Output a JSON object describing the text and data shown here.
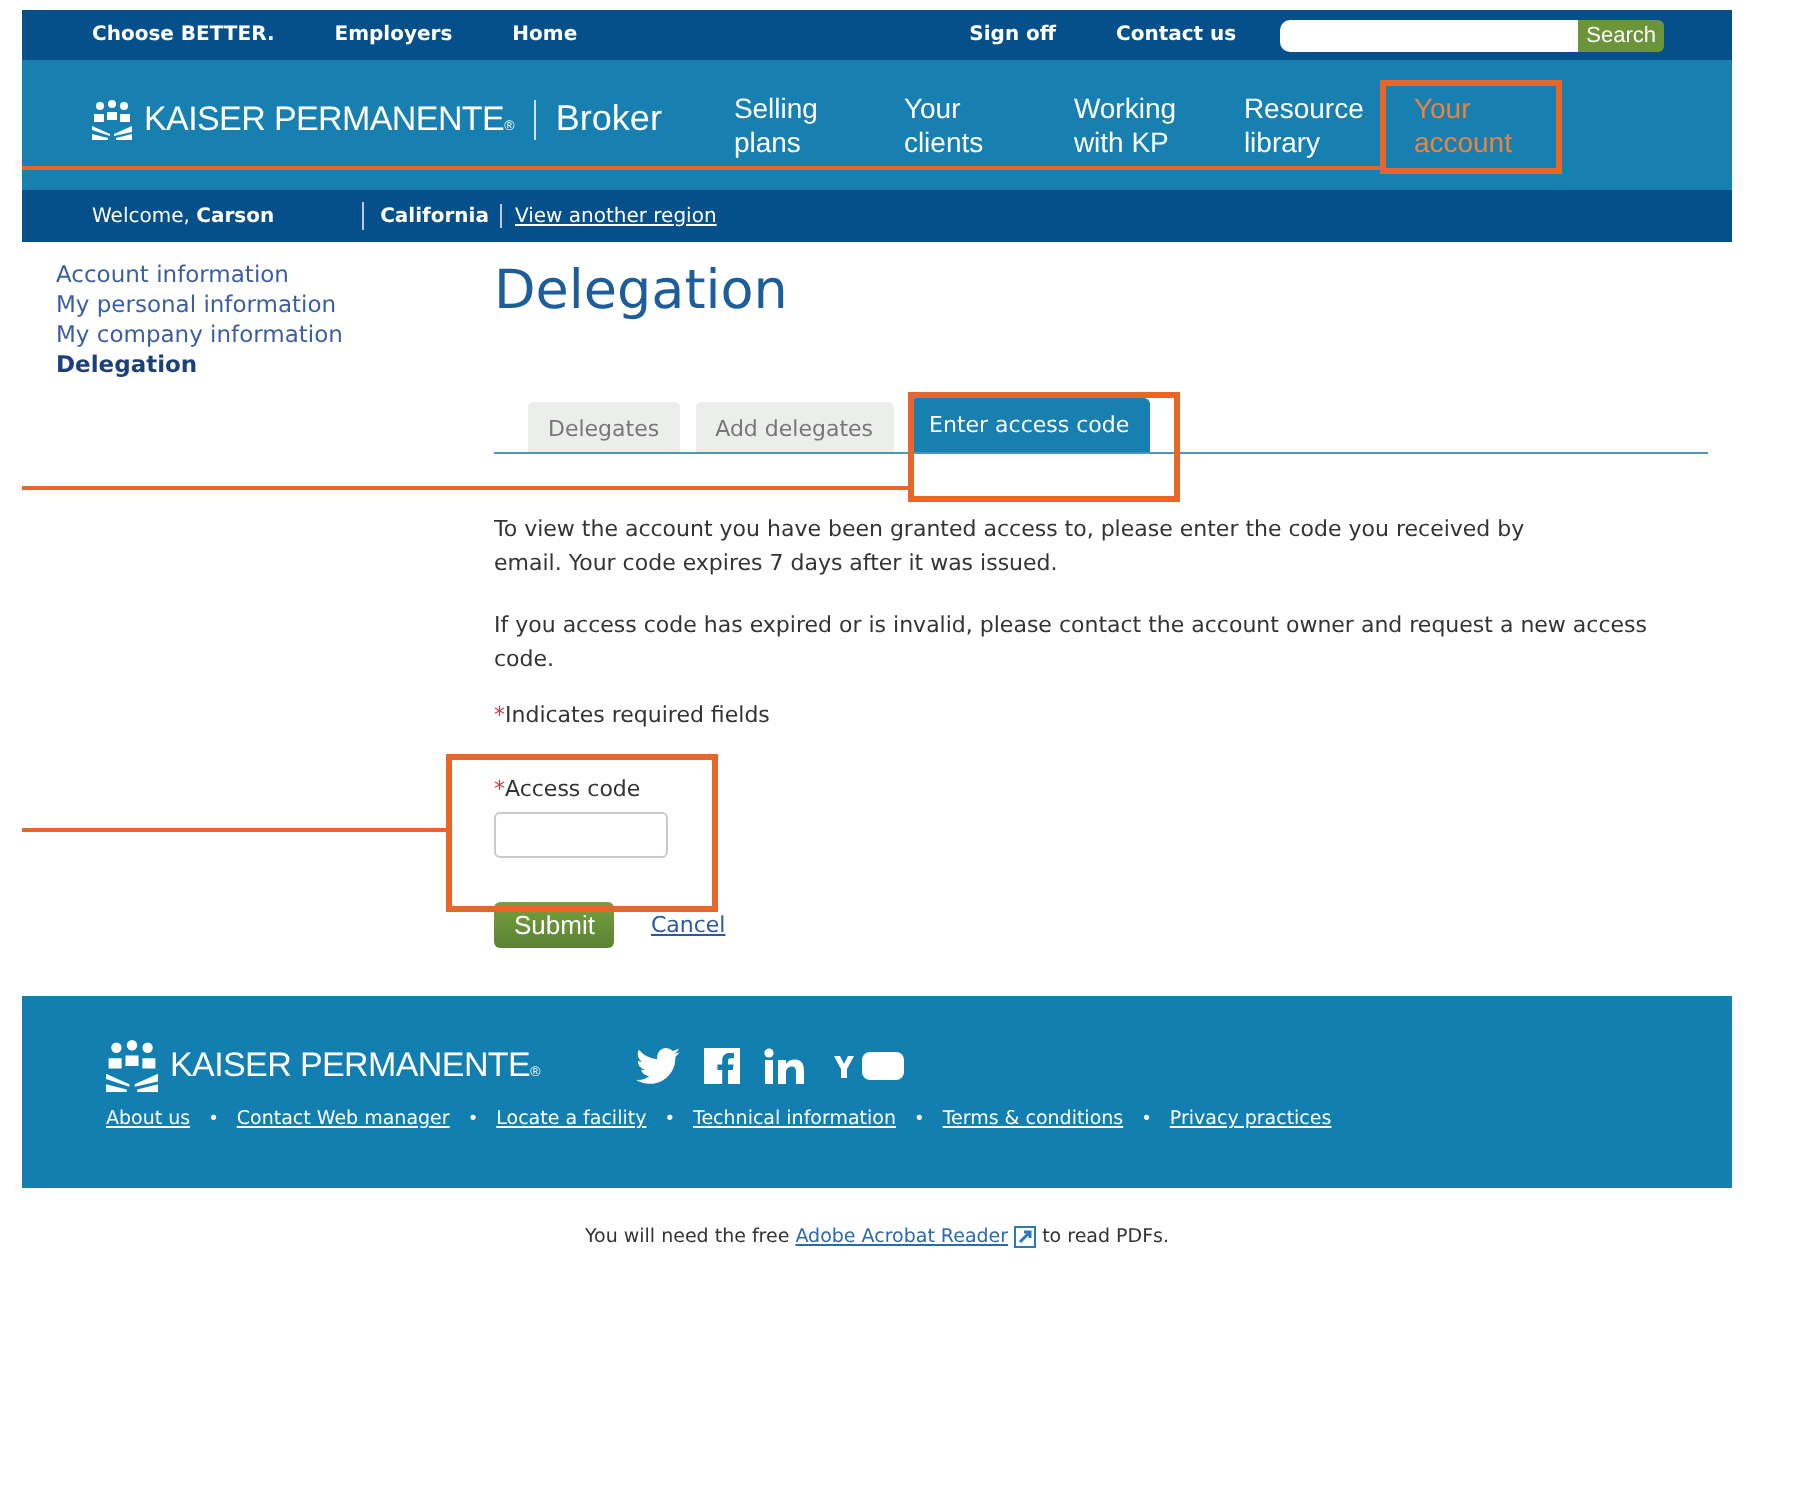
{
  "top_bar": {
    "links": [
      "Choose BETTER.",
      "Employers",
      "Home"
    ],
    "right_links": [
      "Sign off",
      "Contact us"
    ],
    "search": {
      "button": "Search"
    }
  },
  "header": {
    "logo_text": "KAISER PERMANENTE$_{®}$",
    "section": "Broker",
    "nav": [
      {
        "label": "Selling plans",
        "selected": false
      },
      {
        "label": "Your clients",
        "selected": false
      },
      {
        "label": "Working with KP",
        "selected": false
      },
      {
        "label": "Resource library",
        "selected": false
      },
      {
        "label": "Your account",
        "selected": true
      }
    ]
  },
  "welcome_bar": {
    "greeting": "Welcome, **Carson**",
    "region": "California",
    "link": "View another region"
  },
  "sidebar": {
    "items": [
      {
        "label": "Account information",
        "selected": false
      },
      {
        "label": "My personal information",
        "selected": false
      },
      {
        "label": "My company information",
        "selected": false
      },
      {
        "label": "Delegation",
        "selected": true
      }
    ]
  },
  "main": {
    "title": "Delegation",
    "tabs": [
      {
        "label": "Delegates",
        "selected": false
      },
      {
        "label": "Add delegates",
        "selected": false
      },
      {
        "label": "Enter access code",
        "selected": true
      }
    ],
    "paragraphs": [
      "To view the account you have been granted access to, please enter the code you received by email. Your code expires 7 days after it was issued.",
      "If you access code has expired or is invalid, please contact the account owner and request a new access code."
    ],
    "required_note": {
      "mark": "*",
      "text": "Indicates required fields"
    },
    "field": {
      "mark": "*",
      "label": "Access code"
    },
    "submit": "Submit",
    "cancel": "Cancel"
  },
  "footer": {
    "logo_text": "KAISER PERMANENTE$_{®}$",
    "links": [
      "About us",
      "Contact Web manager",
      "Locate a facility",
      "Technical information",
      "Terms & conditions",
      "Privacy practices"
    ],
    "separator": "•"
  },
  "pdf_note": {
    "before": "You will need the free",
    "link": "Adobe Acrobat Reader",
    "after": "to read PDFs."
  }
}
